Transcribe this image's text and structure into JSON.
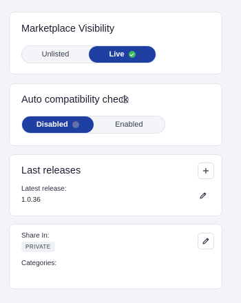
{
  "marketplace": {
    "title": "Marketplace Visibility",
    "options": [
      "Unlisted",
      "Live"
    ],
    "selected": "Live",
    "live_status_color": "#3bb85a"
  },
  "compat": {
    "title": "Auto compatibility check",
    "info_icon": "info-icon",
    "options": [
      "Disabled",
      "Enabled"
    ],
    "selected": "Disabled"
  },
  "releases": {
    "title": "Last releases",
    "add_icon": "plus-icon",
    "latest_label": "Latest release:",
    "latest_value": "1.0.36",
    "edit_icon": "pencil-icon"
  },
  "share": {
    "share_label": "Share In:",
    "share_value": "PRIVATE",
    "categories_label": "Categories:",
    "edit_icon": "pencil-icon"
  },
  "colors": {
    "accent": "#1f3fa3",
    "background": "#f3f4f7",
    "card": "#ffffff"
  }
}
